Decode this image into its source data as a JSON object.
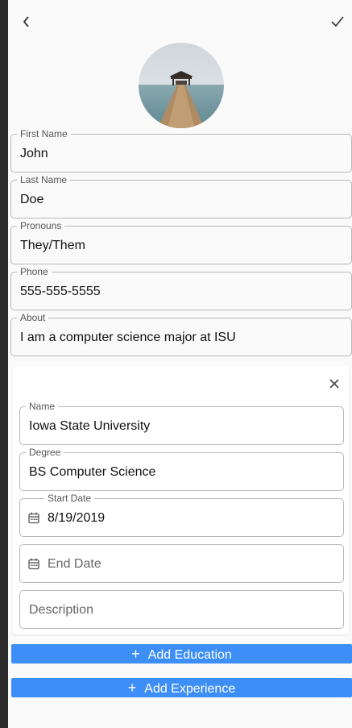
{
  "header": {
    "back_icon": "chevron-left-icon",
    "save_icon": "check-icon"
  },
  "profile": {
    "first_name": {
      "label": "First Name",
      "value": "John"
    },
    "last_name": {
      "label": "Last Name",
      "value": "Doe"
    },
    "pronouns": {
      "label": "Pronouns",
      "value": "They/Them"
    },
    "phone": {
      "label": "Phone",
      "value": "555-555-5555"
    },
    "about": {
      "label": "About",
      "value": "I am a computer science major at ISU"
    }
  },
  "education": {
    "close_icon": "close-icon",
    "name": {
      "label": "Name",
      "value": "Iowa State University"
    },
    "degree": {
      "label": "Degree",
      "value": "BS Computer Science"
    },
    "start_date": {
      "label": "Start Date",
      "value": "8/19/2019"
    },
    "end_date": {
      "placeholder": "End Date"
    },
    "description": {
      "placeholder": "Description"
    }
  },
  "actions": {
    "add_education": "Add Education",
    "add_experience": "Add Experience"
  },
  "colors": {
    "accent": "#3d8ef7",
    "border": "#b8b8b8",
    "background": "#fafafa"
  }
}
